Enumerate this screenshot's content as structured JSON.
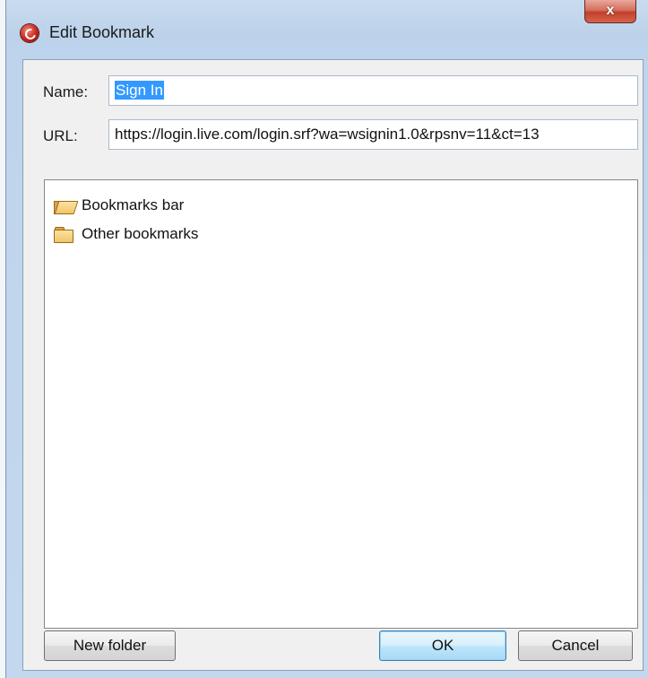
{
  "window": {
    "title": "Edit Bookmark",
    "close_label": "x"
  },
  "form": {
    "name_label": "Name:",
    "name_value": "Sign In",
    "url_label": "URL:",
    "url_value": "https://login.live.com/login.srf?wa=wsignin1.0&rpsnv=11&ct=13"
  },
  "tree": {
    "items": [
      {
        "label": "Bookmarks bar",
        "icon": "folder-open-icon",
        "selected": true
      },
      {
        "label": "Other bookmarks",
        "icon": "folder-icon",
        "selected": false
      }
    ]
  },
  "buttons": {
    "new_folder": "New folder",
    "ok": "OK",
    "cancel": "Cancel"
  }
}
